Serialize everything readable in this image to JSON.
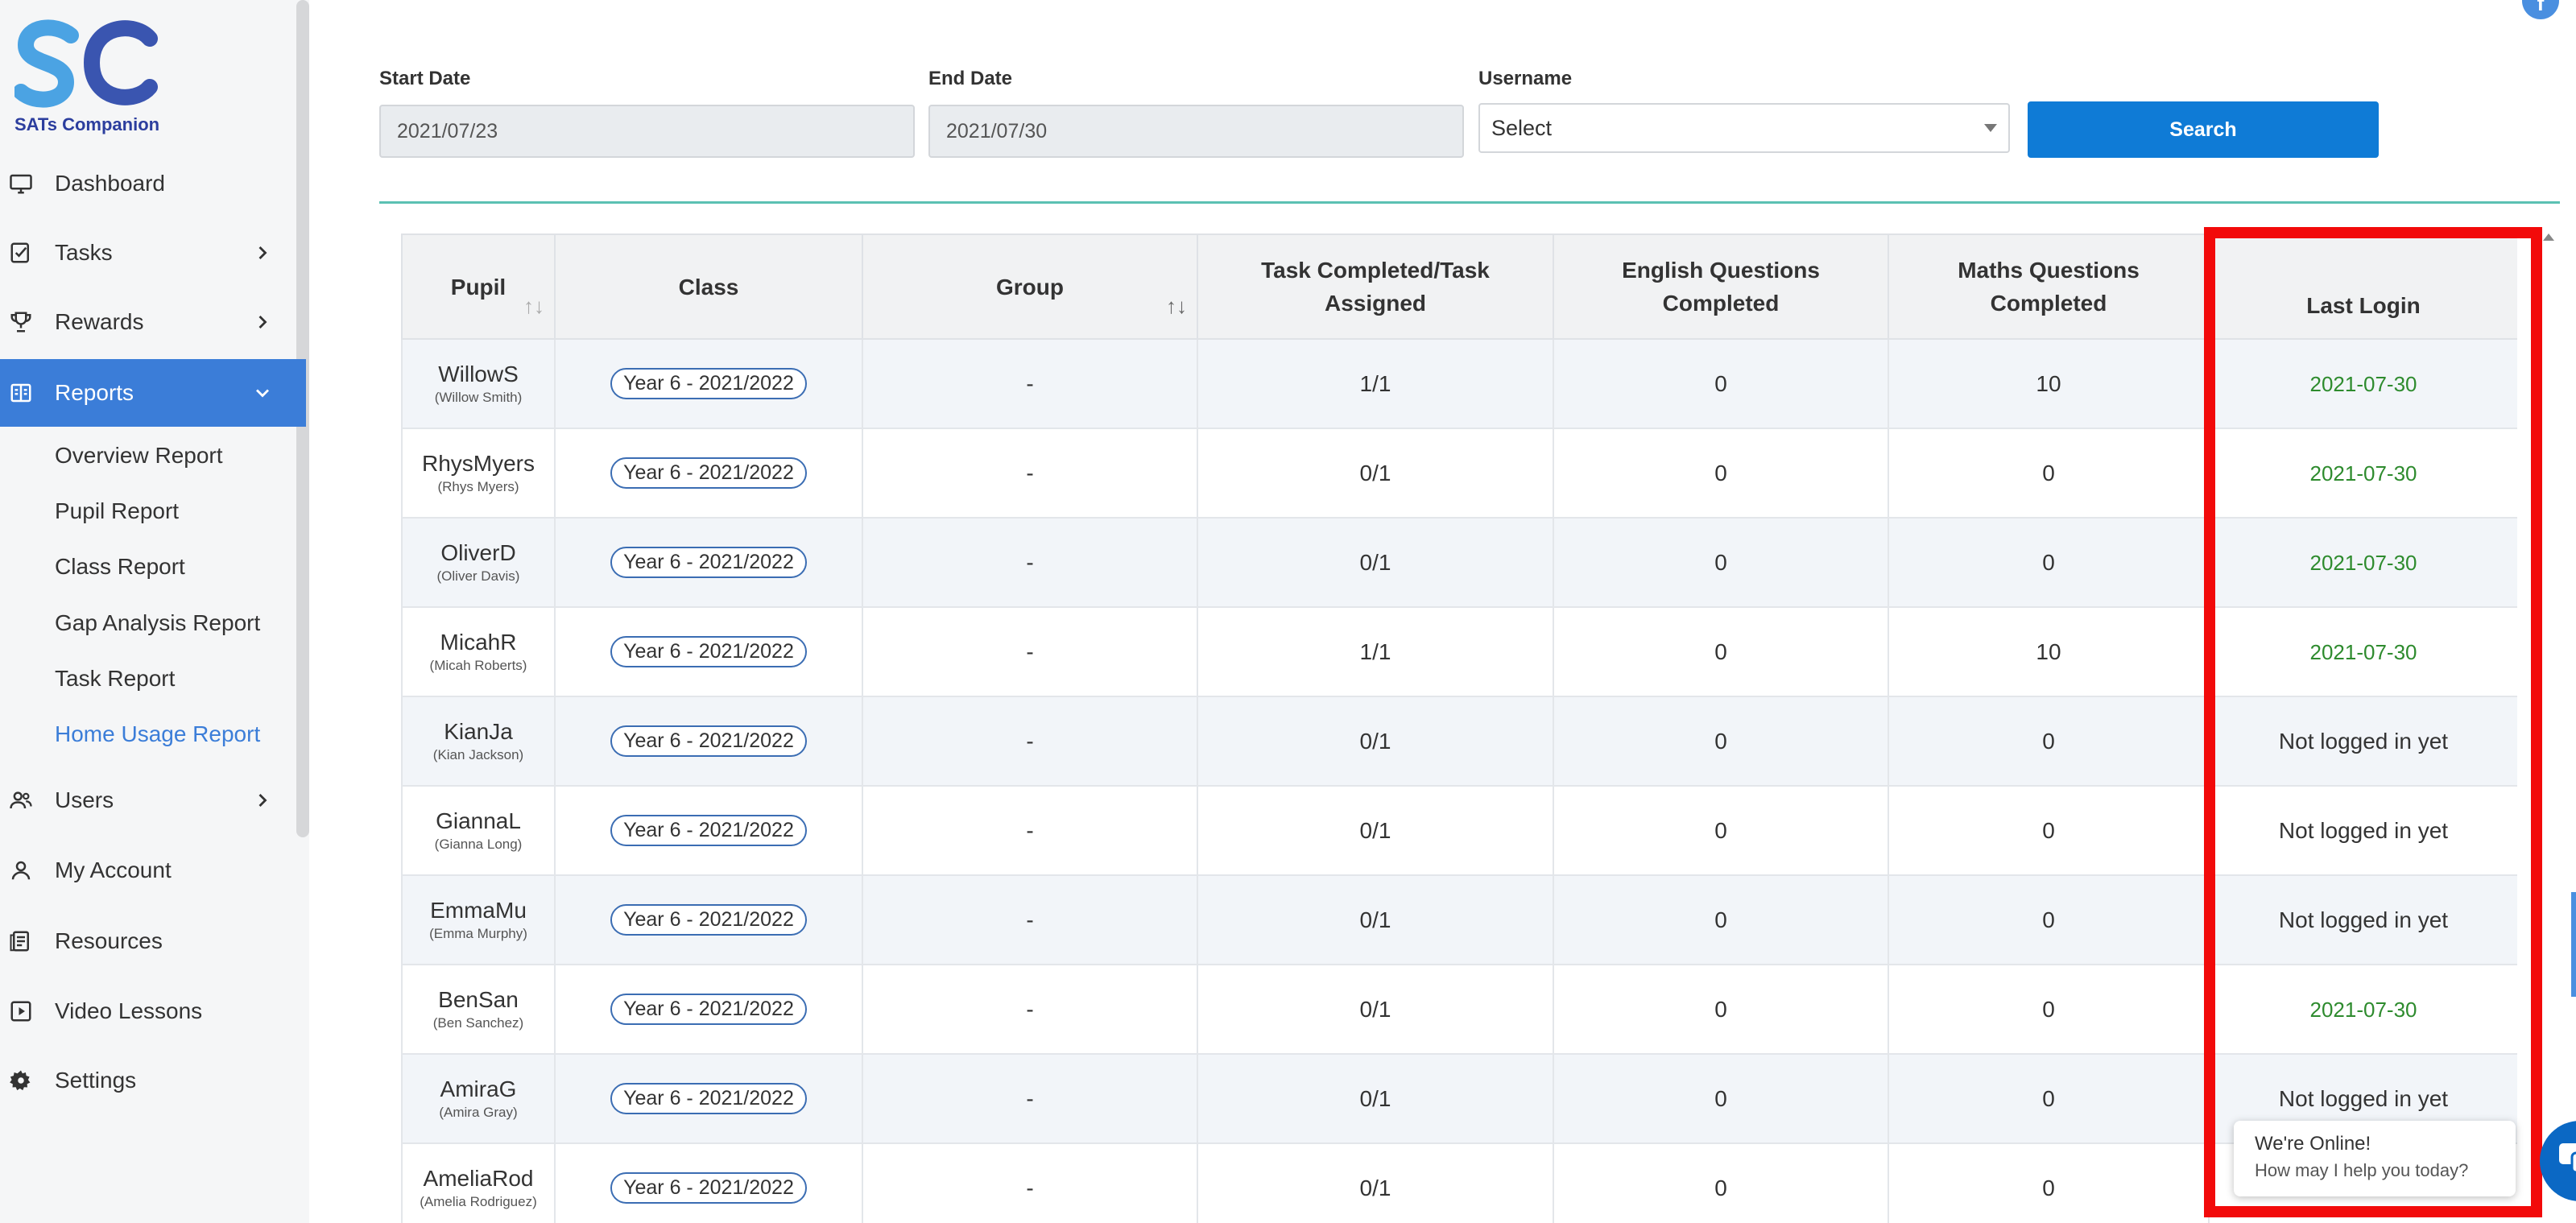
{
  "brand": {
    "name": "SATs Companion"
  },
  "nav": {
    "items": [
      {
        "key": "dashboard",
        "label": "Dashboard",
        "icon": "monitor-icon",
        "has_chevron": false
      },
      {
        "key": "tasks",
        "label": "Tasks",
        "icon": "checklist-icon",
        "has_chevron": true
      },
      {
        "key": "rewards",
        "label": "Rewards",
        "icon": "trophy-icon",
        "has_chevron": true
      },
      {
        "key": "reports",
        "label": "Reports",
        "icon": "report-icon",
        "has_chevron": true,
        "active": true
      },
      {
        "key": "users",
        "label": "Users",
        "icon": "users-icon",
        "has_chevron": true
      },
      {
        "key": "my_account",
        "label": "My Account",
        "icon": "account-icon",
        "has_chevron": false
      },
      {
        "key": "resources",
        "label": "Resources",
        "icon": "resources-icon",
        "has_chevron": false
      },
      {
        "key": "video_lessons",
        "label": "Video Lessons",
        "icon": "video-icon",
        "has_chevron": false
      },
      {
        "key": "settings",
        "label": "Settings",
        "icon": "gear-icon",
        "has_chevron": false
      }
    ],
    "reports_sub": [
      "Overview Report",
      "Pupil Report",
      "Class Report",
      "Gap Analysis Report",
      "Task Report",
      "Home Usage Report"
    ],
    "active_sub": "Home Usage Report"
  },
  "filters": {
    "start_date_label": "Start Date",
    "start_date_value": "2021/07/23",
    "end_date_label": "End Date",
    "end_date_value": "2021/07/30",
    "username_label": "Username",
    "username_value": "Select",
    "search_label": "Search"
  },
  "table": {
    "headers": {
      "pupil": "Pupil",
      "class": "Class",
      "group": "Group",
      "task": "Task Completed/Task Assigned",
      "english": "English Questions Completed",
      "maths": "Maths Questions Completed",
      "last_login": "Last Login"
    },
    "rows": [
      {
        "username": "WillowS",
        "fullname": "(Willow Smith)",
        "class": "Year 6 - 2021/2022",
        "group": "-",
        "task": "1/1",
        "english": "0",
        "maths": "10",
        "last_login": "2021-07-30"
      },
      {
        "username": "RhysMyers",
        "fullname": "(Rhys Myers)",
        "class": "Year 6 - 2021/2022",
        "group": "-",
        "task": "0/1",
        "english": "0",
        "maths": "0",
        "last_login": "2021-07-30"
      },
      {
        "username": "OliverD",
        "fullname": "(Oliver Davis)",
        "class": "Year 6 - 2021/2022",
        "group": "-",
        "task": "0/1",
        "english": "0",
        "maths": "0",
        "last_login": "2021-07-30"
      },
      {
        "username": "MicahR",
        "fullname": "(Micah Roberts)",
        "class": "Year 6 - 2021/2022",
        "group": "-",
        "task": "1/1",
        "english": "0",
        "maths": "10",
        "last_login": "2021-07-30"
      },
      {
        "username": "KianJa",
        "fullname": "(Kian Jackson)",
        "class": "Year 6 - 2021/2022",
        "group": "-",
        "task": "0/1",
        "english": "0",
        "maths": "0",
        "last_login": "Not logged in yet"
      },
      {
        "username": "GiannaL",
        "fullname": "(Gianna Long)",
        "class": "Year 6 - 2021/2022",
        "group": "-",
        "task": "0/1",
        "english": "0",
        "maths": "0",
        "last_login": "Not logged in yet"
      },
      {
        "username": "EmmaMu",
        "fullname": "(Emma Murphy)",
        "class": "Year 6 - 2021/2022",
        "group": "-",
        "task": "0/1",
        "english": "0",
        "maths": "0",
        "last_login": "Not logged in yet"
      },
      {
        "username": "BenSan",
        "fullname": "(Ben Sanchez)",
        "class": "Year 6 - 2021/2022",
        "group": "-",
        "task": "0/1",
        "english": "0",
        "maths": "0",
        "last_login": "2021-07-30"
      },
      {
        "username": "AmiraG",
        "fullname": "(Amira Gray)",
        "class": "Year 6 - 2021/2022",
        "group": "-",
        "task": "0/1",
        "english": "0",
        "maths": "0",
        "last_login": "Not logged in yet"
      },
      {
        "username": "AmeliaRod",
        "fullname": "(Amelia Rodriguez)",
        "class": "Year 6 - 2021/2022",
        "group": "-",
        "task": "0/1",
        "english": "0",
        "maths": "0",
        "last_login": ""
      }
    ]
  },
  "chat": {
    "title": "We're Online!",
    "subtitle": "How may I help you today?"
  },
  "colors": {
    "accent": "#3b7dd8",
    "search_button": "#0f7bd6",
    "login_date": "#2e8b2e",
    "highlight": "#f20a0a",
    "divider": "#5bc1b3"
  }
}
